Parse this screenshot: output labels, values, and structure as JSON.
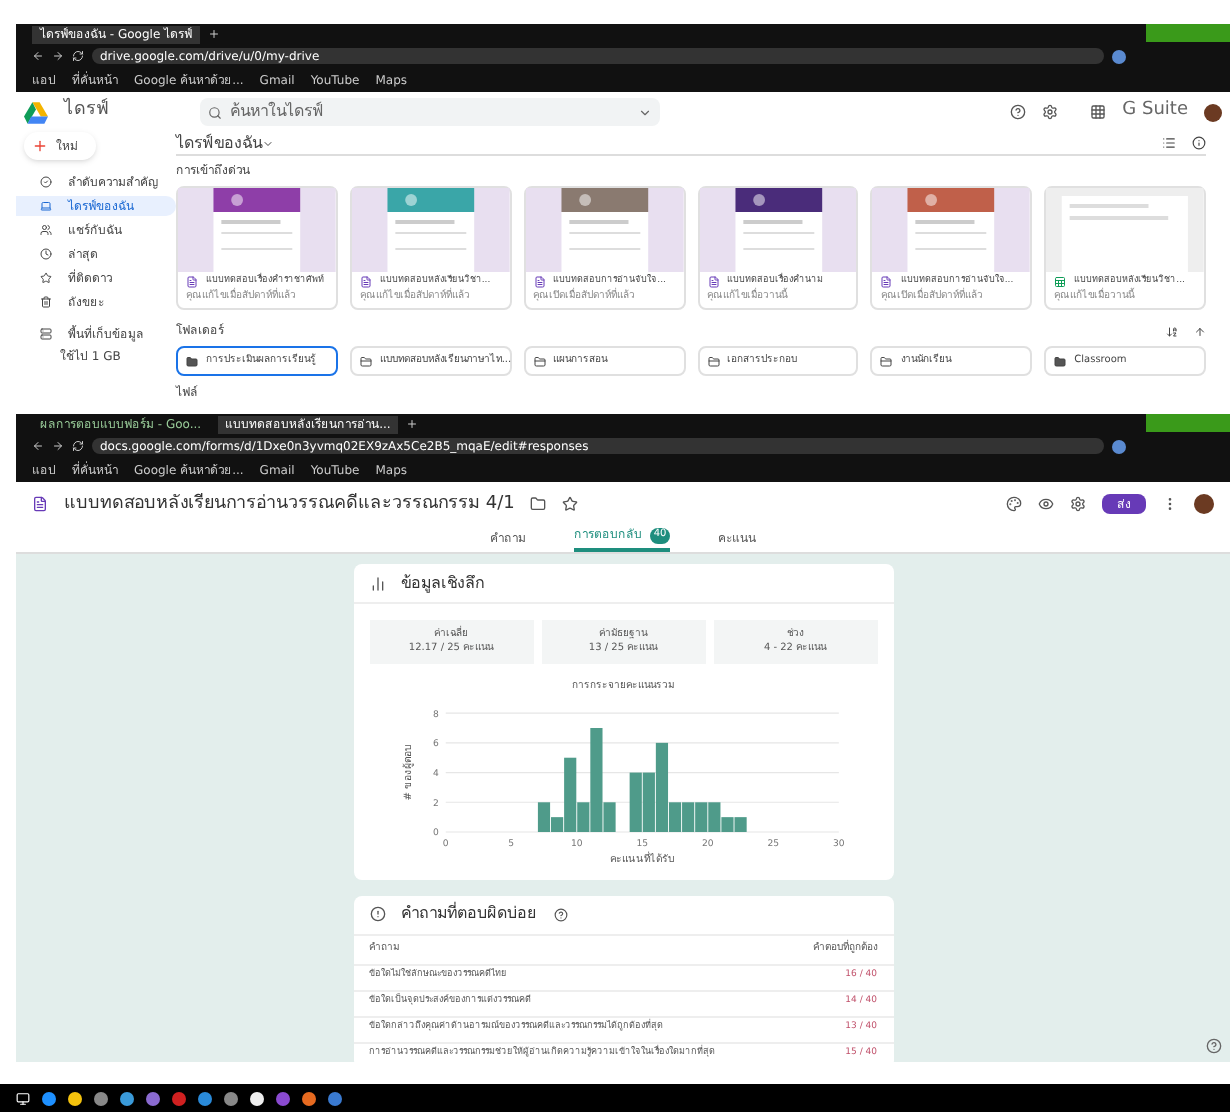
{
  "drive_window": {
    "tab": "ไดรฟ์ของฉัน - Google ไดรฟ์",
    "url": "drive.google.com/drive/u/0/my-drive",
    "bookmarks": [
      "แอป",
      "ที่คั่นหน้า",
      "Google ค้นหาด้วย...",
      "Gmail",
      "YouTube",
      "Maps"
    ],
    "app_name": "ไดรฟ์",
    "search": {
      "placeholder": "ค้นหาในไดรฟ์"
    },
    "brand": "G Suite",
    "new_button": "ใหม่",
    "breadcrumb": "ไดรฟ์ของฉัน",
    "sidebar": [
      {
        "label": "ลำดับความสำคัญ",
        "selected": false
      },
      {
        "label": "ไดรฟ์ของฉัน",
        "selected": true
      },
      {
        "label": "แชร์กับฉัน",
        "selected": false
      },
      {
        "label": "ล่าสุด",
        "selected": false
      },
      {
        "label": "ที่ติดดาว",
        "selected": false
      },
      {
        "label": "ถังขยะ",
        "selected": false
      }
    ],
    "storage": {
      "label": "พื้นที่เก็บข้อมูล",
      "usage": "ใช้ไป 1 GB"
    },
    "quick_access": "การเข้าถึงด่วน",
    "files": [
      {
        "title": "แบบทดสอบเรื่องคำราชาศัพท์",
        "sub": "คุณแก้ไขเมื่อสัปดาห์ที่แล้ว",
        "kind": "form"
      },
      {
        "title": "แบบทดสอบหลังเรียนวิชา...",
        "sub": "คุณแก้ไขเมื่อสัปดาห์ที่แล้ว",
        "kind": "form"
      },
      {
        "title": "แบบทดสอบการอ่านจับใจ...",
        "sub": "คุณเปิดเมื่อสัปดาห์ที่แล้ว",
        "kind": "form"
      },
      {
        "title": "แบบทดสอบเรื่องคำนาม",
        "sub": "คุณแก้ไขเมื่อวานนี้",
        "kind": "form"
      },
      {
        "title": "แบบทดสอบการอ่านจับใจ...",
        "sub": "คุณเปิดเมื่อสัปดาห์ที่แล้ว",
        "kind": "form"
      },
      {
        "title": "แบบทดสอบหลังเรียนวิชา...",
        "sub": "คุณแก้ไขเมื่อวานนี้",
        "kind": "sheet"
      }
    ],
    "folders_label": "โฟลเดอร์",
    "folders": [
      {
        "name": "การประเมินผลการเรียนรู้",
        "shared": false,
        "selected": true
      },
      {
        "name": "แบบทดสอบหลังเรียนภาษาไท...",
        "shared": true,
        "selected": false
      },
      {
        "name": "แผนการสอน",
        "shared": true,
        "selected": false
      },
      {
        "name": "เอกสารประกอบ",
        "shared": true,
        "selected": false
      },
      {
        "name": "งานนักเรียน",
        "shared": true,
        "selected": false
      },
      {
        "name": "Classroom",
        "shared": false,
        "selected": false
      }
    ],
    "files_label": "ไฟล์"
  },
  "forms_window": {
    "tabs": [
      {
        "label": "ผลการตอบแบบฟอร์ม - Goo...",
        "selected": false
      },
      {
        "label": "แบบทดสอบหลังเรียนการอ่าน...",
        "selected": true
      }
    ],
    "url": "docs.google.com/forms/d/1Dxe0n3yvmq02EX9zAx5Ce2B5_mqaE/edit#responses",
    "bookmarks": [
      "แอป",
      "ที่คั่นหน้า",
      "Google ค้นหาด้วย...",
      "Gmail",
      "YouTube",
      "Maps"
    ],
    "title": "แบบทดสอบหลังเรียนการอ่านวรรณคดีและวรรณกรรม 4/1",
    "send_button": "ส่ง",
    "tabs_form": [
      {
        "label": "คำถาม",
        "selected": false
      },
      {
        "label": "การตอบกลับ",
        "badge": "40",
        "selected": true
      },
      {
        "label": "คะแนน",
        "selected": false
      }
    ],
    "insights": {
      "title": "ข้อมูลเชิงลึก",
      "stats": [
        {
          "label": "ค่าเฉลี่ย",
          "value": "12.17 / 25 คะแนน"
        },
        {
          "label": "ค่ามัธยฐาน",
          "value": "13 / 25 คะแนน"
        },
        {
          "label": "ช่วง",
          "value": "4 - 22 คะแนน"
        }
      ],
      "chart_data": {
        "type": "bar",
        "title": "การกระจายคะแนนรวม",
        "xlabel": "คะแนนที่ได้รับ",
        "ylabel": "# ของผู้ตอบ",
        "x": [
          7.5,
          8.5,
          9.5,
          10.5,
          11.5,
          12.5,
          13.5,
          14.5,
          15.5,
          16.5,
          17.5,
          18.5,
          19.5,
          20.5,
          21.5,
          22.5
        ],
        "grid": true,
        "series": [
          {
            "color": "#4f9b8a",
            "values": [
              2,
              1,
              5,
              2,
              7,
              2,
              0,
              4,
              4,
              6,
              2,
              2,
              2,
              2,
              1,
              1
            ]
          }
        ],
        "xlim": [
          0,
          30
        ],
        "ylim": [
          0,
          8
        ],
        "xticks": [
          0,
          5,
          10,
          15,
          20,
          25,
          30
        ],
        "yticks": [
          0,
          2,
          4,
          6,
          8
        ]
      }
    },
    "missed": {
      "title": "คำถามที่ตอบผิดบ่อย",
      "col_question": "คำถาม",
      "col_correct": "คำตอบที่ถูกต้อง",
      "rows": [
        {
          "q": "ข้อใดไม่ใช่ลักษณะของวรรณคดีไทย",
          "score": "16 / 40"
        },
        {
          "q": "ข้อใดเป็นจุดประสงค์ของการแต่งวรรณคดี",
          "score": "14 / 40"
        },
        {
          "q": "ข้อใดกล่าวถึงคุณค่าด้านอารมณ์ของวรรณคดีและวรรณกรรมได้ถูกต้องที่สุด",
          "score": "13 / 40"
        },
        {
          "q": "การอ่านวรรณคดีและวรรณกรรมช่วยให้ผู้อ่านเกิดความรู้ความเข้าใจในเรื่องใดมากที่สุด",
          "score": "15 / 40"
        }
      ]
    }
  }
}
